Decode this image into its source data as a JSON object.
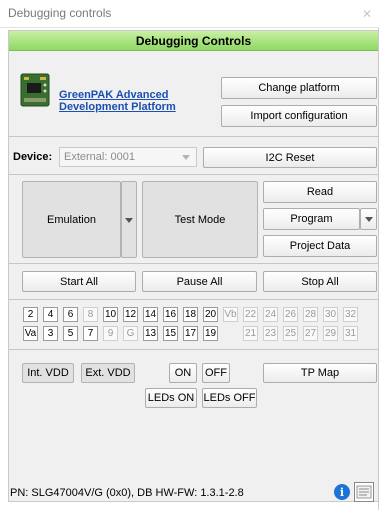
{
  "window": {
    "title": "Debugging controls"
  },
  "header": {
    "title": "Debugging Controls"
  },
  "platform": {
    "link_line1": "GreenPAK Advanced",
    "link_line2": "Development Platform",
    "change_platform": "Change platform",
    "import_configuration": "Import configuration"
  },
  "device": {
    "label": "Device:",
    "value": "External: 0001",
    "i2c_reset": "I2C Reset"
  },
  "modes": {
    "emulation": "Emulation",
    "test_mode": "Test Mode",
    "read": "Read",
    "program": "Program",
    "project_data": "Project Data"
  },
  "run": {
    "start_all": "Start All",
    "pause_all": "Pause All",
    "stop_all": "Stop All"
  },
  "pins": {
    "row1": [
      {
        "label": "2",
        "enabled": true
      },
      {
        "label": "4",
        "enabled": true
      },
      {
        "label": "6",
        "enabled": true
      },
      {
        "label": "8",
        "enabled": false
      },
      {
        "label": "10",
        "enabled": true
      },
      {
        "label": "12",
        "enabled": true
      },
      {
        "label": "14",
        "enabled": true
      },
      {
        "label": "16",
        "enabled": true
      },
      {
        "label": "18",
        "enabled": true
      },
      {
        "label": "20",
        "enabled": true
      },
      {
        "label": "Vb",
        "enabled": false
      },
      {
        "label": "22",
        "enabled": false
      },
      {
        "label": "24",
        "enabled": false
      },
      {
        "label": "26",
        "enabled": false
      },
      {
        "label": "28",
        "enabled": false
      },
      {
        "label": "30",
        "enabled": false
      },
      {
        "label": "32",
        "enabled": false
      }
    ],
    "row2": [
      {
        "label": "Va",
        "enabled": true
      },
      {
        "label": "3",
        "enabled": true
      },
      {
        "label": "5",
        "enabled": true
      },
      {
        "label": "7",
        "enabled": true
      },
      {
        "label": "9",
        "enabled": false
      },
      {
        "label": "G",
        "enabled": false
      },
      {
        "label": "13",
        "enabled": true
      },
      {
        "label": "15",
        "enabled": true
      },
      {
        "label": "17",
        "enabled": true
      },
      {
        "label": "19",
        "enabled": true
      },
      {
        "label": "",
        "enabled": false
      },
      {
        "label": "21",
        "enabled": false
      },
      {
        "label": "23",
        "enabled": false
      },
      {
        "label": "25",
        "enabled": false
      },
      {
        "label": "27",
        "enabled": false
      },
      {
        "label": "29",
        "enabled": false
      },
      {
        "label": "31",
        "enabled": false
      }
    ]
  },
  "power": {
    "int_vdd": "Int. VDD",
    "ext_vdd": "Ext. VDD",
    "on": "ON",
    "off": "OFF",
    "tp_map": "TP Map",
    "leds_on": "LEDs ON",
    "leds_off": "LEDs OFF"
  },
  "status": {
    "text": "PN: SLG47004V/G (0x0), DB HW-FW: 1.3.1-2.8"
  },
  "icons": {
    "info": "info-icon",
    "board": "board-icon",
    "log": "log-icon",
    "close": "close-icon",
    "dropdown": "chevron-down-icon"
  },
  "colors": {
    "header_green": "#8fd865",
    "link_blue": "#1a4fb3",
    "info_blue": "#1d73d6"
  }
}
